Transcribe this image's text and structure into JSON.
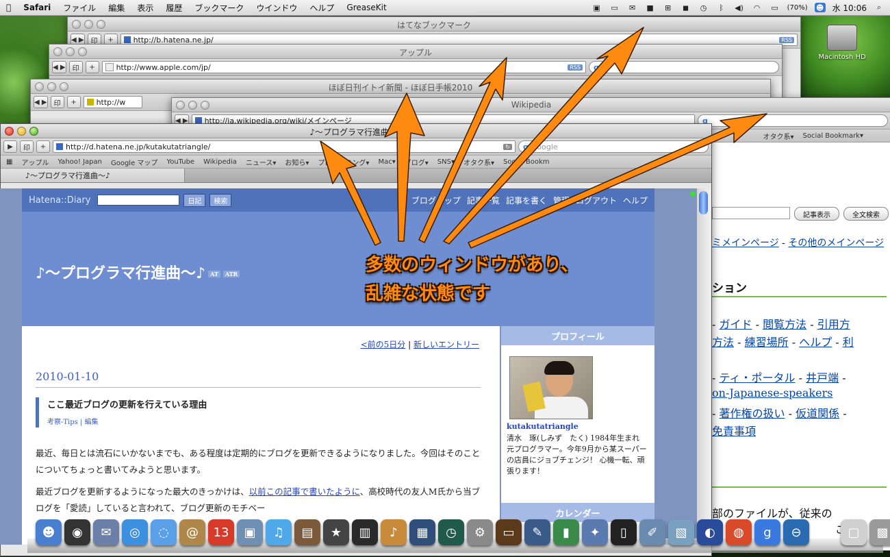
{
  "menubar": {
    "apple": "",
    "items": [
      "Safari",
      "ファイル",
      "編集",
      "表示",
      "履歴",
      "ブックマーク",
      "ウインドウ",
      "ヘルプ",
      "GreaseKit"
    ],
    "battery": "(70%)",
    "clock": "水 10:06"
  },
  "desktop": {
    "hd_label": "Macintosh HD"
  },
  "windows": {
    "hatena_bookmark": {
      "title": "はてなブックマーク",
      "url": "http://b.hatena.ne.jp/"
    },
    "apple": {
      "title": "アップル",
      "url": "http://www.apple.com/jp/"
    },
    "hobonichi": {
      "title": "ほぼ日刊イトイ新聞 - ほぼ日手帳2010",
      "url": "http://w"
    },
    "wikipedia": {
      "title": "Wikipedia",
      "url": "http://ja.wikipedia.org/wiki/メインページ"
    },
    "main": {
      "title": "♪～プログラマ行進曲～♪",
      "url": "http://d.hatena.ne.jp/kutakutatriangle/",
      "search_placeholder": "Google",
      "bookmarks": [
        "アップル",
        "Yahoo! Japan",
        "Google マップ",
        "YouTube",
        "Wikipedia",
        "ニュース▾",
        "お知ら▾",
        "プログラミング▾",
        "Mac▾",
        "ブログ▾",
        "SNS▾",
        "オタク系▾",
        "Social Bookm"
      ],
      "tab_label": "♪～プログラマ行進曲～♪"
    }
  },
  "side_bookmarks": {
    "items": [
      "オタク系▾",
      "Social Bookmark▾"
    ]
  },
  "wiki": {
    "btn_show": "記事表示",
    "btn_search": "全文検索",
    "line1_a": "ミメインページ",
    "line1_sep": " - ",
    "line1_b": "その他のメインページ",
    "heading": "ション",
    "row1": [
      "- ",
      "ガイド",
      " - ",
      "閲覧方法",
      " - ",
      "引用方"
    ],
    "row2": [
      "方法",
      " - ",
      "練習場所",
      " - ",
      "ヘルプ",
      " - ",
      "利"
    ],
    "row3": [
      "- ",
      "ティ・ポータル",
      " - ",
      "井戸端",
      " -"
    ],
    "row4": [
      "on-Japanese-speakers"
    ],
    "row5": [
      "- ",
      "著作権の扱い",
      " - ",
      "仮道関係",
      " -"
    ],
    "row6": [
      "免責事項"
    ],
    "bottom": "部のファイルが、従来の",
    "bottom2": "こご能"
  },
  "hatena": {
    "logo": "Hatena::Diary",
    "btn_diary": "日記",
    "btn_search": "検索",
    "nav": [
      "ブログトップ",
      "記事一覧",
      "記事を書く",
      "管理",
      "ログアウト",
      "ヘルプ"
    ],
    "blog_title": "♪～プログラマ行進曲～♪",
    "badge1": "AT",
    "badge2": "ATR",
    "pager_prev": "<前の5日分",
    "pager_sep": " | ",
    "pager_next": "新しいエントリー",
    "date": "2010-01-10",
    "entry_title": "ここ最近ブログの更新を行えている理由",
    "entry_cat": "考察-Tips",
    "entry_edit": "編集",
    "para1": "最近、毎日とは流石にいかないまでも、ある程度は定期的にブログを更新できるようになりました。今回はそのことについてちょっと書いてみようと思います。",
    "para2_a": "最近ブログを更新するようになった最大のきっかけは、",
    "para2_link": "以前この記事で書いたように",
    "para2_b": "、高校時代の友人M氏から当ブログを「愛読」していると言われて、ブログ更新のモチベー",
    "side_profile": "プロフィール",
    "username": "kutakutatriangle",
    "profile_text": "清水　琢(しみず　たく) 1984年生まれ　元プログラマー。今年9月から某スーパーの店員にジョブチェンジ！ 心機一転、頑張ります！",
    "side_calendar": "カレンダー"
  },
  "annotation": {
    "line1": "多数のウィンドウがあり、",
    "line2": "乱雑な状態です",
    "color": "#ff8a10"
  },
  "dock": {
    "icons": [
      {
        "name": "finder-icon",
        "glyph": "☻",
        "color": "#4a7fd0"
      },
      {
        "name": "dashboard-icon",
        "glyph": "◉",
        "color": "#333333"
      },
      {
        "name": "mail-icon",
        "glyph": "✉",
        "color": "#6b7fa8"
      },
      {
        "name": "safari-icon",
        "glyph": "◎",
        "color": "#3d8fe0"
      },
      {
        "name": "ichat-icon",
        "glyph": "◌",
        "color": "#5aa0e8"
      },
      {
        "name": "address-book-icon",
        "glyph": "@",
        "color": "#b0874a"
      },
      {
        "name": "ical-icon",
        "glyph": "13",
        "color": "#d83a2a"
      },
      {
        "name": "preview-icon",
        "glyph": "▣",
        "color": "#6f8fb3"
      },
      {
        "name": "itunes-icon",
        "glyph": "♫",
        "color": "#4fa8e8"
      },
      {
        "name": "iphoto-icon",
        "glyph": "▤",
        "color": "#7a5a3a"
      },
      {
        "name": "imovie-icon",
        "glyph": "★",
        "color": "#444444"
      },
      {
        "name": "idvd-icon",
        "glyph": "▥",
        "color": "#2a2a2a"
      },
      {
        "name": "garageband-icon",
        "glyph": "♪",
        "color": "#c78b3a"
      },
      {
        "name": "spaces-icon",
        "glyph": "▦",
        "color": "#2f4f7a"
      },
      {
        "name": "time-machine-icon",
        "glyph": "◷",
        "color": "#1f5a4a"
      },
      {
        "name": "system-preferences-icon",
        "glyph": "⚙",
        "color": "#8a8a8a"
      },
      {
        "name": "keynote-icon",
        "glyph": "▭",
        "color": "#5a3a1a"
      },
      {
        "name": "pen-icon",
        "glyph": "✎",
        "color": "#3a5a8a"
      },
      {
        "name": "numbers-icon",
        "glyph": "▮",
        "color": "#3a8a4a"
      },
      {
        "name": "xcode-icon",
        "glyph": "✦",
        "color": "#5a7ab0"
      },
      {
        "name": "terminal-icon",
        "glyph": "▯",
        "color": "#222222"
      },
      {
        "name": "textedit-icon",
        "glyph": "✐",
        "color": "#6a8ab0"
      },
      {
        "name": "photo-app-icon",
        "glyph": "▧",
        "color": "#7aa0c0"
      },
      {
        "name": "firefox-icon",
        "glyph": "◐",
        "color": "#2a4a9a"
      },
      {
        "name": "chrome-icon",
        "glyph": "◍",
        "color": "#d84a2a"
      },
      {
        "name": "google-icon",
        "glyph": "g",
        "color": "#3a7ae0"
      },
      {
        "name": "network-icon",
        "glyph": "⊖",
        "color": "#2a6ab0"
      },
      {
        "name": "gap-icon",
        "glyph": " ",
        "color": "transparent"
      },
      {
        "name": "document-icon",
        "glyph": "▢",
        "color": "#d0d0d0"
      },
      {
        "name": "stack-icon",
        "glyph": "▩",
        "color": "#9a9a9a"
      },
      {
        "name": "trash-icon",
        "glyph": "♻",
        "color": "#7a7a7a"
      }
    ]
  }
}
